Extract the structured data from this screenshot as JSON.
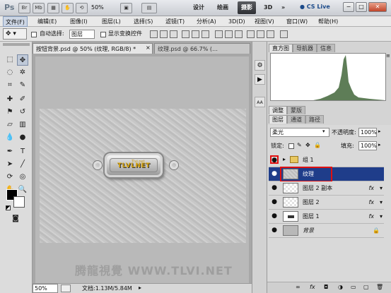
{
  "titlebar": {
    "app_logo": "Ps",
    "buttons": [
      "Br",
      "Mb"
    ],
    "zoom_value": "50%",
    "workspaces": [
      "设计",
      "绘画",
      "摄影",
      "3D"
    ],
    "active_workspace": "摄影",
    "more": "»",
    "cslive": "CS Live",
    "win_min": "−",
    "win_max": "□",
    "win_close": "✕"
  },
  "menubar": {
    "items": [
      "文件(F)",
      "编辑(E)",
      "图像(I)",
      "图层(L)",
      "选择(S)",
      "滤镜(T)",
      "分析(A)",
      "3D(D)",
      "视图(V)",
      "窗口(W)",
      "帮助(H)"
    ]
  },
  "options": {
    "auto_select_label": "自动选择:",
    "auto_select_value": "图层",
    "show_transform_label": "显示变换控件"
  },
  "tabs": [
    {
      "label": "按钮背景.psd @ 50% (纹理, RGB/8) *",
      "active": true
    },
    {
      "label": "纹理.psd @ 66.7% (…",
      "active": false
    }
  ],
  "canvas": {
    "plate_logo": "TLVLNET",
    "plate_sub": "Tlvi.net",
    "watermark": "腾龍視覺 WWW.TLVI.NET"
  },
  "statusbar": {
    "zoom": "50%",
    "docinfo": "文档:1.13M/5.84M"
  },
  "panels": {
    "histogram_tabs": [
      "直方图",
      "导航器",
      "信息"
    ],
    "adjust_tabs": [
      "调整",
      "蒙版"
    ],
    "layers_tabs": [
      "图层",
      "通道",
      "路径"
    ],
    "blend_mode": "柔光",
    "opacity_label": "不透明度:",
    "opacity_value": "100%",
    "lock_label": "锁定:",
    "fill_label": "填充:",
    "fill_value": "100%",
    "layers": [
      {
        "name": "组 1",
        "type": "group",
        "fx": "",
        "active": false
      },
      {
        "name": "纹理",
        "type": "layer",
        "fx": "",
        "active": true
      },
      {
        "name": "图层 2 副本",
        "type": "layer",
        "fx": "fx",
        "active": false
      },
      {
        "name": "图层 2",
        "type": "layer",
        "fx": "fx",
        "active": false
      },
      {
        "name": "图层 1",
        "type": "layer",
        "fx": "fx",
        "active": false
      },
      {
        "name": "背景",
        "type": "background",
        "fx": "",
        "active": false
      }
    ]
  },
  "colors": {
    "selected_layer": "#1f3d8a",
    "highlight_red": "#e01010",
    "histogram_fill": "#5e7d57"
  }
}
